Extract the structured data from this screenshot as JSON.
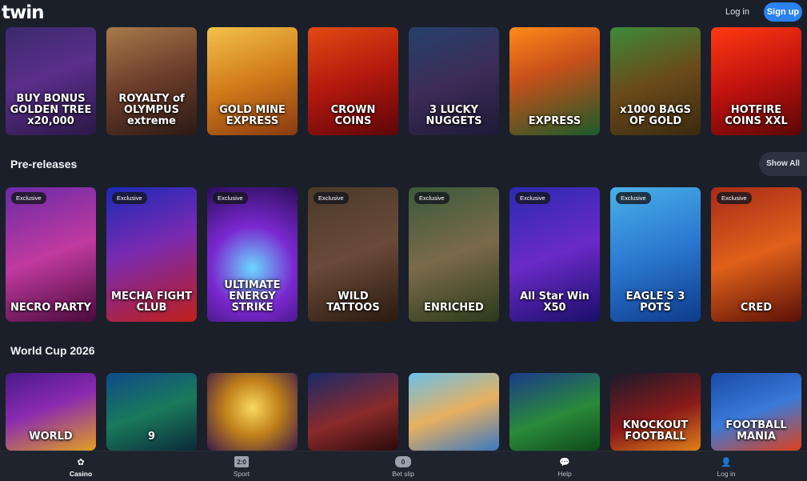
{
  "header": {
    "logo": "twin",
    "login": "Log in",
    "signup": "Sign up"
  },
  "rows": {
    "top": {
      "tiles": [
        {
          "name": "BUY BONUS GOLDEN TREE x20,000",
          "bg": "linear-gradient(160deg,#3b2a6e,#5a2e8a 45%,#2a1846)"
        },
        {
          "name": "ROYALTY of OLYMPUS extreme",
          "bg": "linear-gradient(160deg,#a87a4a,#6b3c2a 50%,#2b1a14)"
        },
        {
          "name": "GOLD MINE EXPRESS",
          "bg": "linear-gradient(160deg,#f3c24a,#d07a1a 50%,#8a3a10)"
        },
        {
          "name": "CROWN COINS",
          "bg": "linear-gradient(160deg,#e14a12,#b1180e 50%,#5d0608)"
        },
        {
          "name": "3 LUCKY NUGGETS",
          "bg": "linear-gradient(160deg,#24416a,#3d2c58 50%,#1d1a36)"
        },
        {
          "name": "EXPRESS",
          "bg": "linear-gradient(160deg,#ff8a1a,#c9501a 40%,#1b5a2a)"
        },
        {
          "name": "x1000 BAGS OF GOLD",
          "bg": "linear-gradient(160deg,#3d8a3a,#6a4a1a 50%,#3a2a10)"
        },
        {
          "name": "HOTFIRE COINS XXL",
          "bg": "linear-gradient(160deg,#ff3a12,#c0120e 50%,#5a0606)"
        }
      ]
    },
    "prereleases": {
      "title": "Pre-releases",
      "show_all": "Show All",
      "badge": "Exclusive",
      "tiles": [
        {
          "name": "NECRO PARTY",
          "bg": "linear-gradient(160deg,#6a2aa8,#c03aa0 50%,#4a0a3a)"
        },
        {
          "name": "MECHA FIGHT CLUB",
          "bg": "linear-gradient(160deg,#1a2ab8,#7a2ab0 45%,#c0201a)"
        },
        {
          "name": "ULTIMATE ENERGY STRIKE",
          "bg": "radial-gradient(circle at 50% 60%,#6ad8ff,#7a28d0 45%,#2a0e5a)"
        },
        {
          "name": "WILD TATTOOS",
          "bg": "linear-gradient(160deg,#4a3a2a,#6a4a38 50%,#2a1a10)"
        },
        {
          "name": "ENRICHED",
          "bg": "linear-gradient(160deg,#3a5a3a,#7a6a4a 50%,#2a3a1a)"
        },
        {
          "name": "All Star Win X50",
          "bg": "linear-gradient(160deg,#2a2ab0,#6a2ac8 50%,#1a0e6a)"
        },
        {
          "name": "EAGLE'S 3 POTS",
          "bg": "linear-gradient(160deg,#4ab0e8,#2a78d0 50%,#0e3a8a)"
        },
        {
          "name": "CRED",
          "bg": "linear-gradient(160deg,#a82a1a,#e0601a 50%,#5a1008)"
        }
      ]
    },
    "worldcup": {
      "title": "World Cup 2026",
      "tiles": [
        {
          "name": "WORLD",
          "bg": "linear-gradient(160deg,#4a1a8a,#8a2ab0 45%,#e0a020)"
        },
        {
          "name": "9",
          "bg": "linear-gradient(160deg,#0e4a8a,#1a7a5a 50%,#0a2a3a)"
        },
        {
          "name": "",
          "bg": "radial-gradient(circle at 50% 45%,#f8d860,#c0801a 45%,#3a1a4a)"
        },
        {
          "name": "",
          "bg": "linear-gradient(160deg,#1a2a6a,#8a2a2a 55%,#2a0a0a)"
        },
        {
          "name": "",
          "bg": "linear-gradient(160deg,#6ac0e8,#e8b060 50%,#3a78c0)"
        },
        {
          "name": "",
          "bg": "linear-gradient(160deg,#1a3a8a,#2a8a3a 55%,#0e4a1a)"
        },
        {
          "name": "KNOCKOUT FOOTBALL",
          "bg": "linear-gradient(160deg,#1a1a2a,#8a1a1a 55%,#e0801a)"
        },
        {
          "name": "FOOTBALL MANIA",
          "bg": "linear-gradient(160deg,#1a4aa8,#3a7ad8 50%,#e0401a)"
        }
      ]
    }
  },
  "bottom_nav": [
    {
      "label": "Casino",
      "icon": "casino-icon",
      "glyph": "✿",
      "active": true
    },
    {
      "label": "Sport",
      "icon": "sport-icon",
      "glyph": "2:0",
      "active": false
    },
    {
      "label": "Bet slip",
      "icon": "bet-slip-icon",
      "glyph": "0",
      "active": false
    },
    {
      "label": "Help",
      "icon": "help-icon",
      "glyph": "💬",
      "active": false
    },
    {
      "label": "Log in",
      "icon": "user-icon",
      "glyph": "👤",
      "active": false
    }
  ]
}
